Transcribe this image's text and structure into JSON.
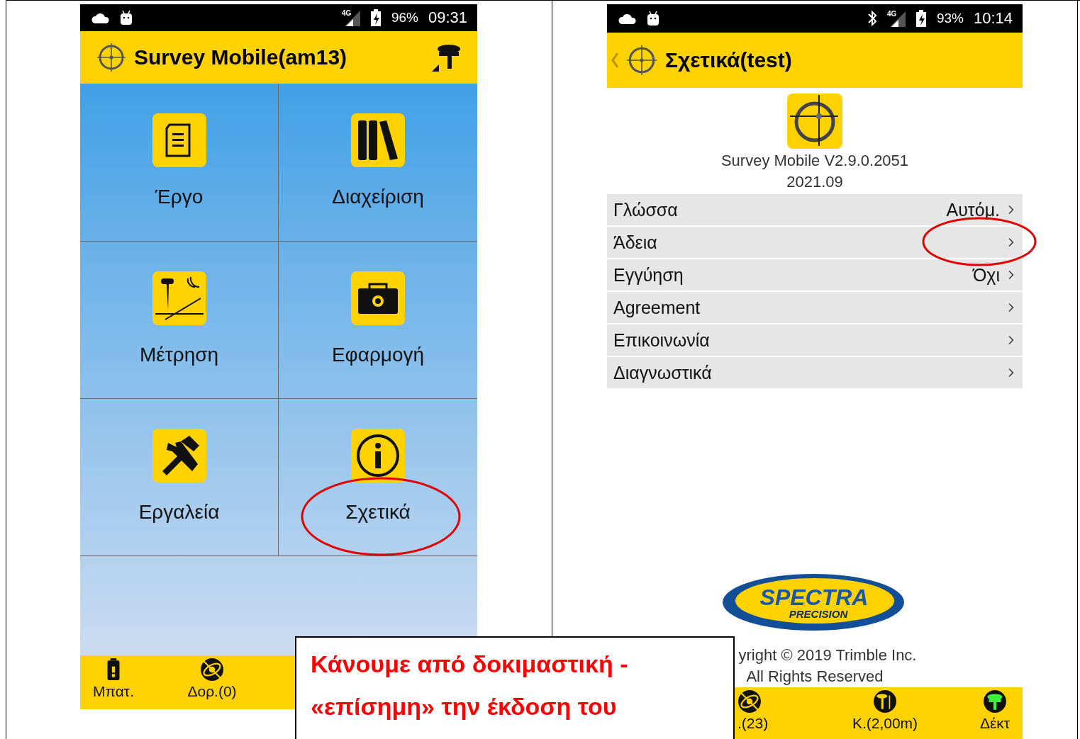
{
  "left_phone": {
    "status_bar": {
      "network": "4G",
      "battery": "96%",
      "time": "09:31",
      "bluetooth": false
    },
    "title": "Survey Mobile(am13)",
    "tiles": [
      {
        "label": "Έργο",
        "kind": "document"
      },
      {
        "label": "Διαχείριση",
        "kind": "books"
      },
      {
        "label": "Μέτρηση",
        "kind": "survey"
      },
      {
        "label": "Εφαρμογή",
        "kind": "toolbox"
      },
      {
        "label": "Εργαλεία",
        "kind": "tools"
      },
      {
        "label": "Σχετικά",
        "kind": "info"
      }
    ],
    "bottom_bar": [
      {
        "label": "Μπατ.",
        "kind": "battery"
      },
      {
        "label": "Δορ.(0)",
        "kind": "satellite"
      }
    ]
  },
  "right_phone": {
    "status_bar": {
      "network": "4G",
      "battery": "93%",
      "time": "10:14",
      "bluetooth": true
    },
    "title": "Σχετικά(test)",
    "version": "Survey Mobile V2.9.0.2051",
    "date": "2021.09",
    "settings": [
      {
        "label": "Γλώσσα",
        "value": "Αυτόμ."
      },
      {
        "label": "Άδεια"
      },
      {
        "label": "Εγγύηση",
        "value": "Όχι"
      },
      {
        "label": "Agreement"
      },
      {
        "label": "Επικοινωνία"
      },
      {
        "label": "Διαγνωστικά"
      }
    ],
    "logo": {
      "line1": "SPECTRA",
      "line2": "PRECISION"
    },
    "copyright": "yright © 2019 Trimble Inc.",
    "rights": "All Rights Reserved",
    "bottom_bar": [
      {
        "label": ".(23)",
        "kind": "satellite"
      },
      {
        "label": "K.(2,00m)",
        "kind": "height"
      },
      {
        "label": "Δέκτ",
        "kind": "receiver"
      }
    ]
  },
  "callout": {
    "lines": [
      "Κάνουμε από δοκιμαστική -",
      "«επίσημη» την έκδοση του"
    ]
  }
}
